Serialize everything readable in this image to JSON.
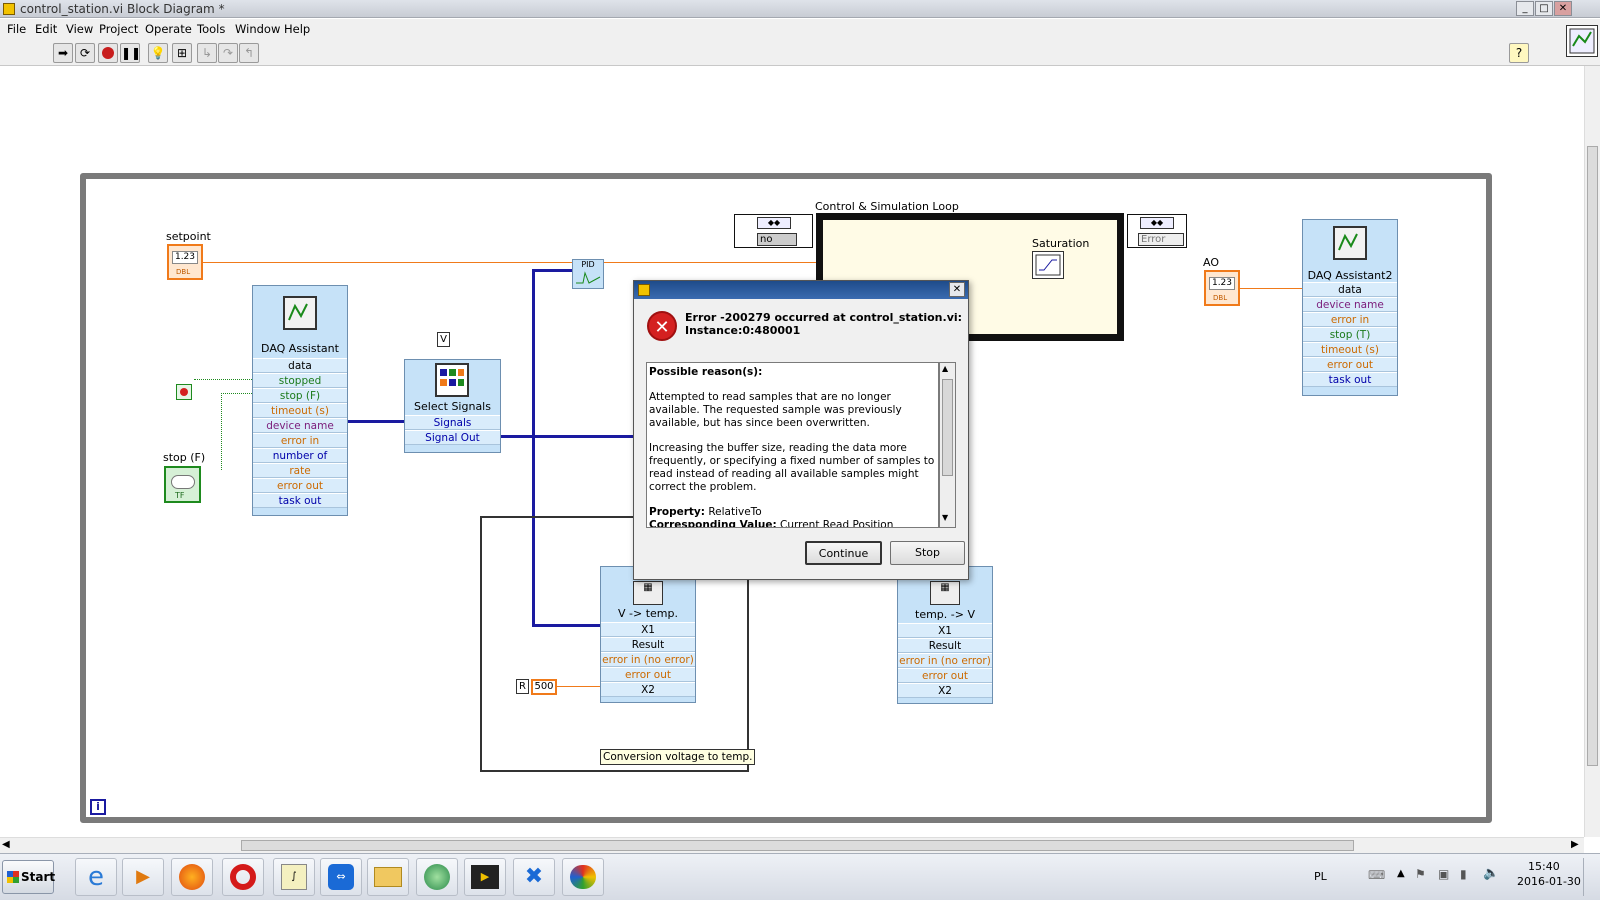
{
  "window": {
    "title": "control_station.vi Block Diagram *",
    "controls": {
      "minimize": "_",
      "maximize": "□",
      "close": "✕"
    }
  },
  "menu": [
    "File",
    "Edit",
    "View",
    "Project",
    "Operate",
    "Tools",
    "Window",
    "Help"
  ],
  "toolbar": {
    "help_icon": "?"
  },
  "diagram": {
    "setpoint_label": "setpoint",
    "setpoint_value": "1.23",
    "setpoint_type": "DBL",
    "stop_label": "stop (F)",
    "stop_type": "TF",
    "daq1": {
      "title": "DAQ Assistant",
      "terminals": [
        "data",
        "stopped",
        "stop (F)",
        "timeout (s)",
        "device name",
        "error in",
        "number of sample",
        "rate",
        "error out",
        "task out"
      ]
    },
    "v_label": "V",
    "select_signals": {
      "title": "Select Signals",
      "terminals": [
        "Signals",
        "Signal Out"
      ]
    },
    "pid_label": "PID",
    "csl_label": "Control & Simulation Loop",
    "csl_left_value": "no",
    "csl_right_value": "Error",
    "saturation_label": "Saturation",
    "ao_label": "AO",
    "ao_value": "1.23",
    "ao_type": "DBL",
    "daq2": {
      "title": "DAQ Assistant2",
      "terminals": [
        "data",
        "device name",
        "error in",
        "stop (T)",
        "timeout (s)",
        "error out",
        "task out"
      ]
    },
    "v_to_temp": {
      "title": "V -> temp.",
      "terminals": [
        "X1",
        "Result",
        "error in (no error)",
        "error out",
        "X2"
      ]
    },
    "temp_to_v": {
      "title": "temp. -> V",
      "terminals": [
        "X1",
        "Result",
        "error in (no error)",
        "error out",
        "X2"
      ]
    },
    "const_r": "R",
    "const_500": "500",
    "comment": "Conversion voltage to temp.",
    "loop_iteration": "i"
  },
  "dialog": {
    "close": "✕",
    "header_line1": "Error -200279 occurred at control_station.vi:",
    "header_line2": "Instance:0:480001",
    "reasons_title": "Possible reason(s):",
    "para1": "Attempted to read samples that are no longer available. The requested sample was previously available, but has since been overwritten.",
    "para2": "Increasing the buffer size, reading the data more frequently, or specifying a fixed number of samples to read instead of reading all available samples might correct the problem.",
    "property_label": "Property:",
    "property_value": "RelativeTo",
    "corresponding_label": "Corresponding Value:",
    "corresponding_value": "Current Read Position",
    "continue_label": "Continue",
    "stop_label": "Stop"
  },
  "taskbar": {
    "start_label": "Start",
    "language": "PL",
    "time": "15:40",
    "date": "2016-01-30",
    "apps": [
      "internet-explorer-icon",
      "media-player-icon",
      "firefox-icon",
      "opera-icon",
      "labview-icon",
      "teamviewer-icon",
      "file-explorer-icon",
      "network-icon",
      "video-icon",
      "tools-icon",
      "paint-icon"
    ]
  },
  "colors": {
    "wire_orange": "#f07a1a",
    "wire_blue": "#1a1aa0",
    "wire_green": "#1e8a1e",
    "block_blue": "#c6e2f8",
    "error_red": "#d42020"
  }
}
